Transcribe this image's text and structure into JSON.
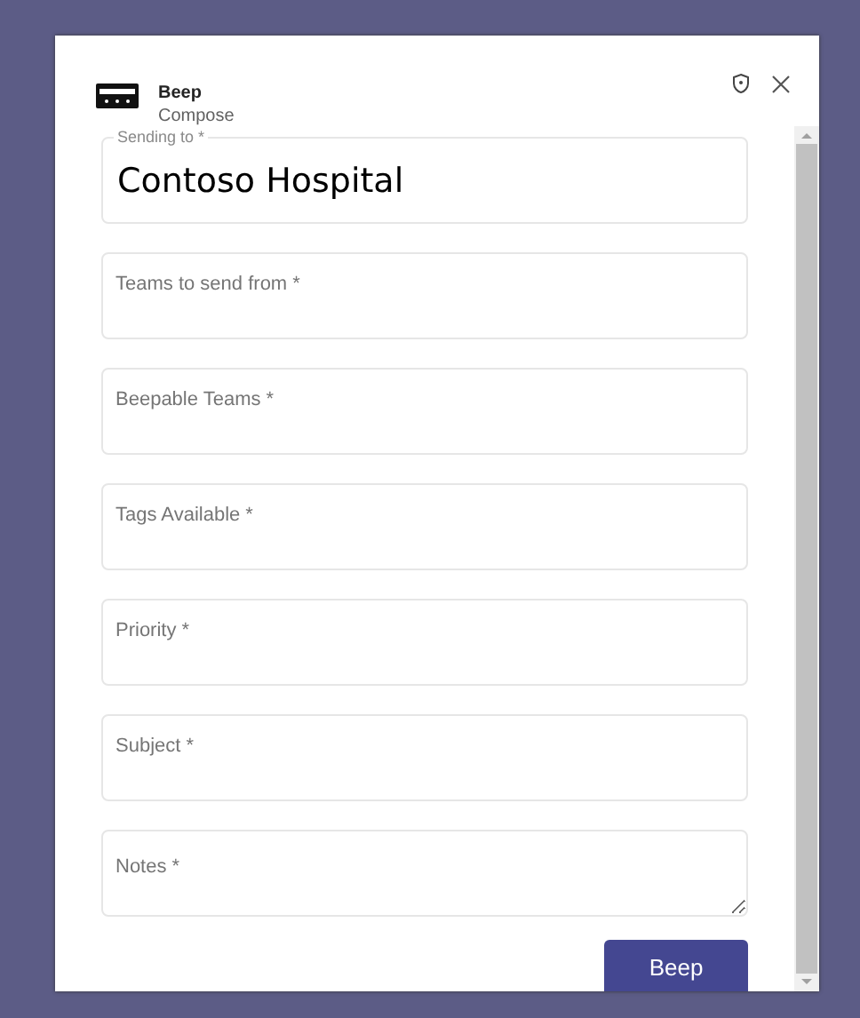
{
  "dialog": {
    "title": "Beep",
    "subtitle": "Compose"
  },
  "fields": [
    {
      "kind": "filled",
      "label": "Sending to *",
      "value": "Contoso Hospital"
    },
    {
      "kind": "text",
      "placeholder": "Teams to send from *"
    },
    {
      "kind": "text",
      "placeholder": "Beepable Teams *"
    },
    {
      "kind": "text",
      "placeholder": "Tags Available *"
    },
    {
      "kind": "text",
      "placeholder": "Priority *"
    },
    {
      "kind": "text",
      "placeholder": "Subject *"
    },
    {
      "kind": "textarea",
      "placeholder": "Notes *"
    }
  ],
  "submit_button": "Beep"
}
